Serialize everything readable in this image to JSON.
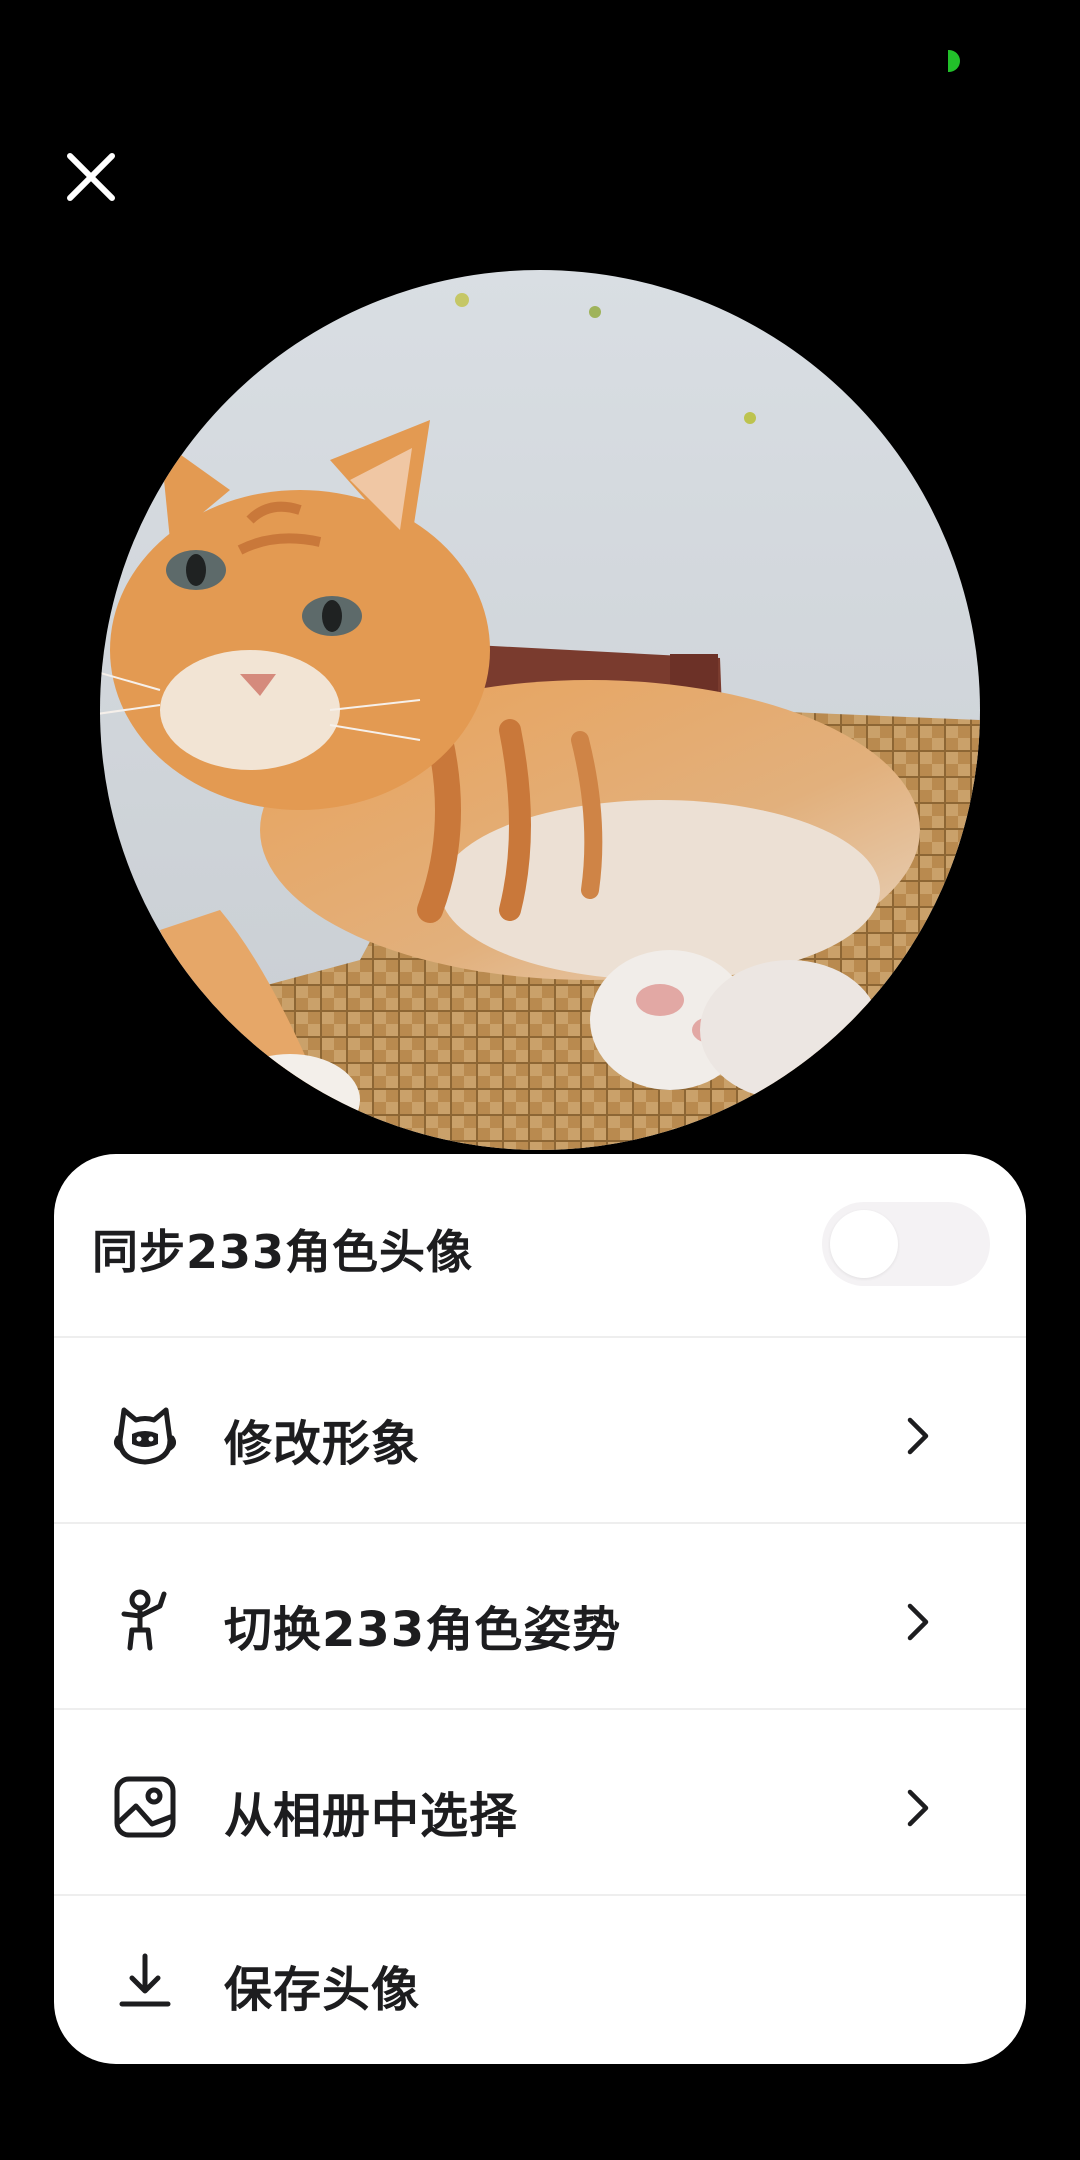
{
  "sync": {
    "label": "同步233角色头像",
    "enabled": false
  },
  "menu": {
    "items": [
      {
        "label": "修改形象",
        "icon": "cat-face-icon",
        "has_chevron": true
      },
      {
        "label": "切换233角色姿势",
        "icon": "character-pose-icon",
        "has_chevron": true
      },
      {
        "label": "从相册中选择",
        "icon": "photo-album-icon",
        "has_chevron": true
      },
      {
        "label": "保存头像",
        "icon": "download-icon",
        "has_chevron": false
      }
    ]
  },
  "icons": {
    "close": "close-icon",
    "status": "status-indicator"
  },
  "colors": {
    "background": "#000000",
    "sheet": "#ffffff",
    "text": "#1d1d1f",
    "status_dot": "#22c02a",
    "toggle_off": "#f4f2f4"
  }
}
